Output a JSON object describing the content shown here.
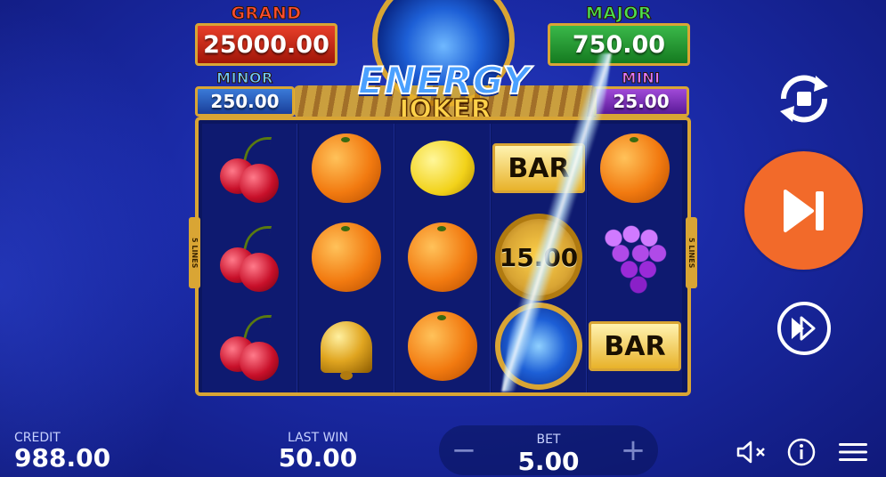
{
  "game": {
    "title_line1": "ENERGY",
    "title_line2": "JOKER"
  },
  "jackpots": {
    "grand": {
      "label": "GRAND",
      "value": "25000.00"
    },
    "major": {
      "label": "MAJOR",
      "value": "750.00"
    },
    "minor": {
      "label": "MINOR",
      "value": "250.00"
    },
    "mini": {
      "label": "MINI",
      "value": "25.00"
    }
  },
  "lines_badge": "5 LINES",
  "reels": [
    [
      "cherry",
      "cherry",
      "cherry"
    ],
    [
      "orange",
      "orange",
      "bell"
    ],
    [
      "lemon",
      "orange",
      "orange"
    ],
    [
      "bar",
      "coin",
      "energy-orb"
    ],
    [
      "orange",
      "grapes",
      "bar"
    ]
  ],
  "symbol_labels": {
    "bar": "BAR",
    "coin_value": "15.00"
  },
  "controls": {
    "autoplay_icon": "autoplay-icon",
    "spin_icon": "play-next-icon",
    "turbo_icon": "fast-forward-icon"
  },
  "bottom": {
    "credit_label": "CREDIT",
    "credit_value": "988.00",
    "last_win_label": "LAST WIN",
    "last_win_value": "50.00",
    "bet_label": "BET",
    "bet_value": "5.00",
    "bet_minus": "−",
    "bet_plus": "+"
  },
  "colors": {
    "spin_button": "#f26a2a",
    "frame_gold": "#d9a534",
    "background": "#1a2aa6"
  }
}
